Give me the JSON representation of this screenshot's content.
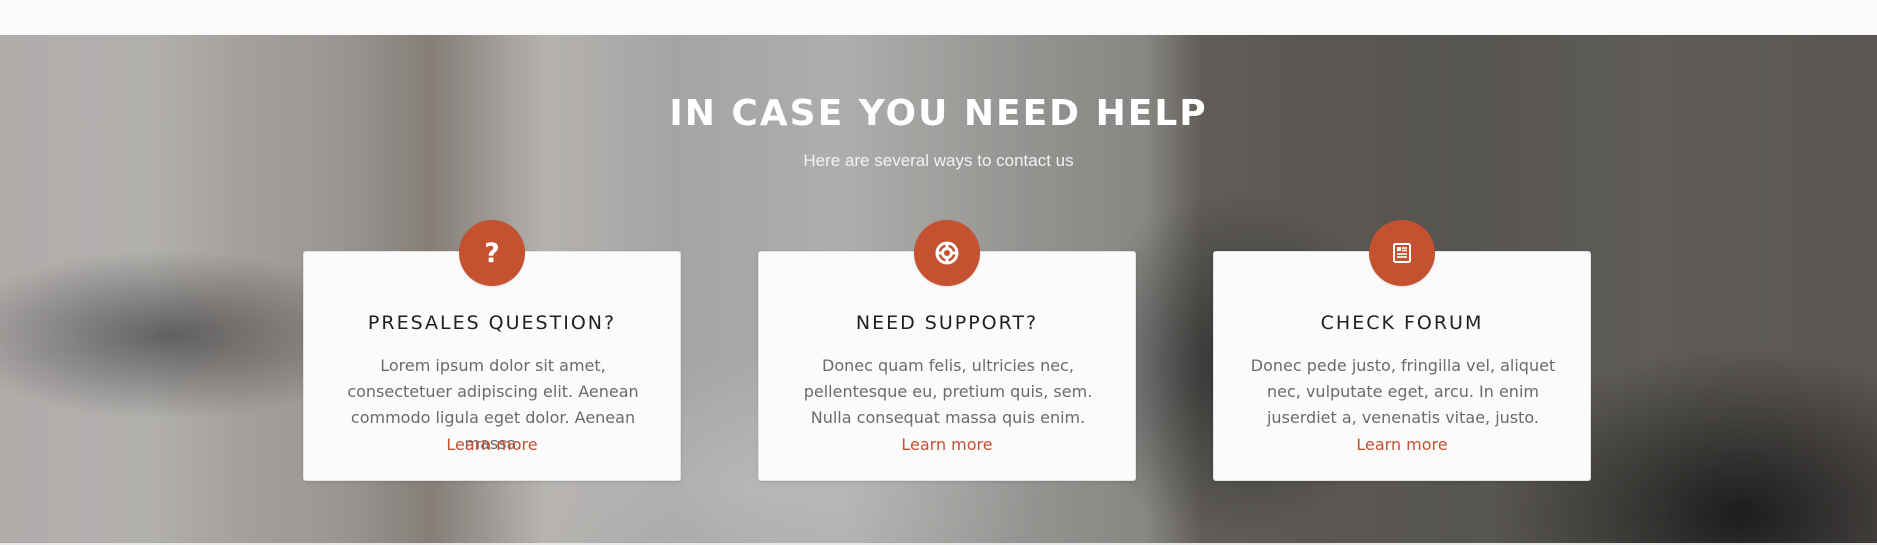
{
  "header": {
    "title": "IN CASE YOU NEED HELP",
    "subtitle": "Here are several ways to contact us"
  },
  "cards": [
    {
      "icon": "question-icon",
      "icon_glyph": "?",
      "title": "PRESALES QUESTION?",
      "text": "Lorem ipsum dolor sit amet, consectetuer adipiscing elit. Aenean commodo ligula eget dolor. Aenean massa.",
      "link": "Learn more"
    },
    {
      "icon": "lifebuoy-icon",
      "title": "NEED SUPPORT?",
      "text": "Donec quam felis, ultricies nec, pellentesque eu, pretium quis, sem. Nulla consequat massa quis enim.",
      "link": "Learn more"
    },
    {
      "icon": "forum-icon",
      "title": "CHECK FORUM",
      "text": "Donec pede justo, fringilla vel, aliquet nec, vulputate eget, arcu. In enim juserdiet a, venenatis vitae, justo.",
      "link": "Learn more"
    }
  ],
  "colors": {
    "accent": "#c4512f",
    "card_background": "#fbfbfb",
    "heading": "#ffffff"
  }
}
